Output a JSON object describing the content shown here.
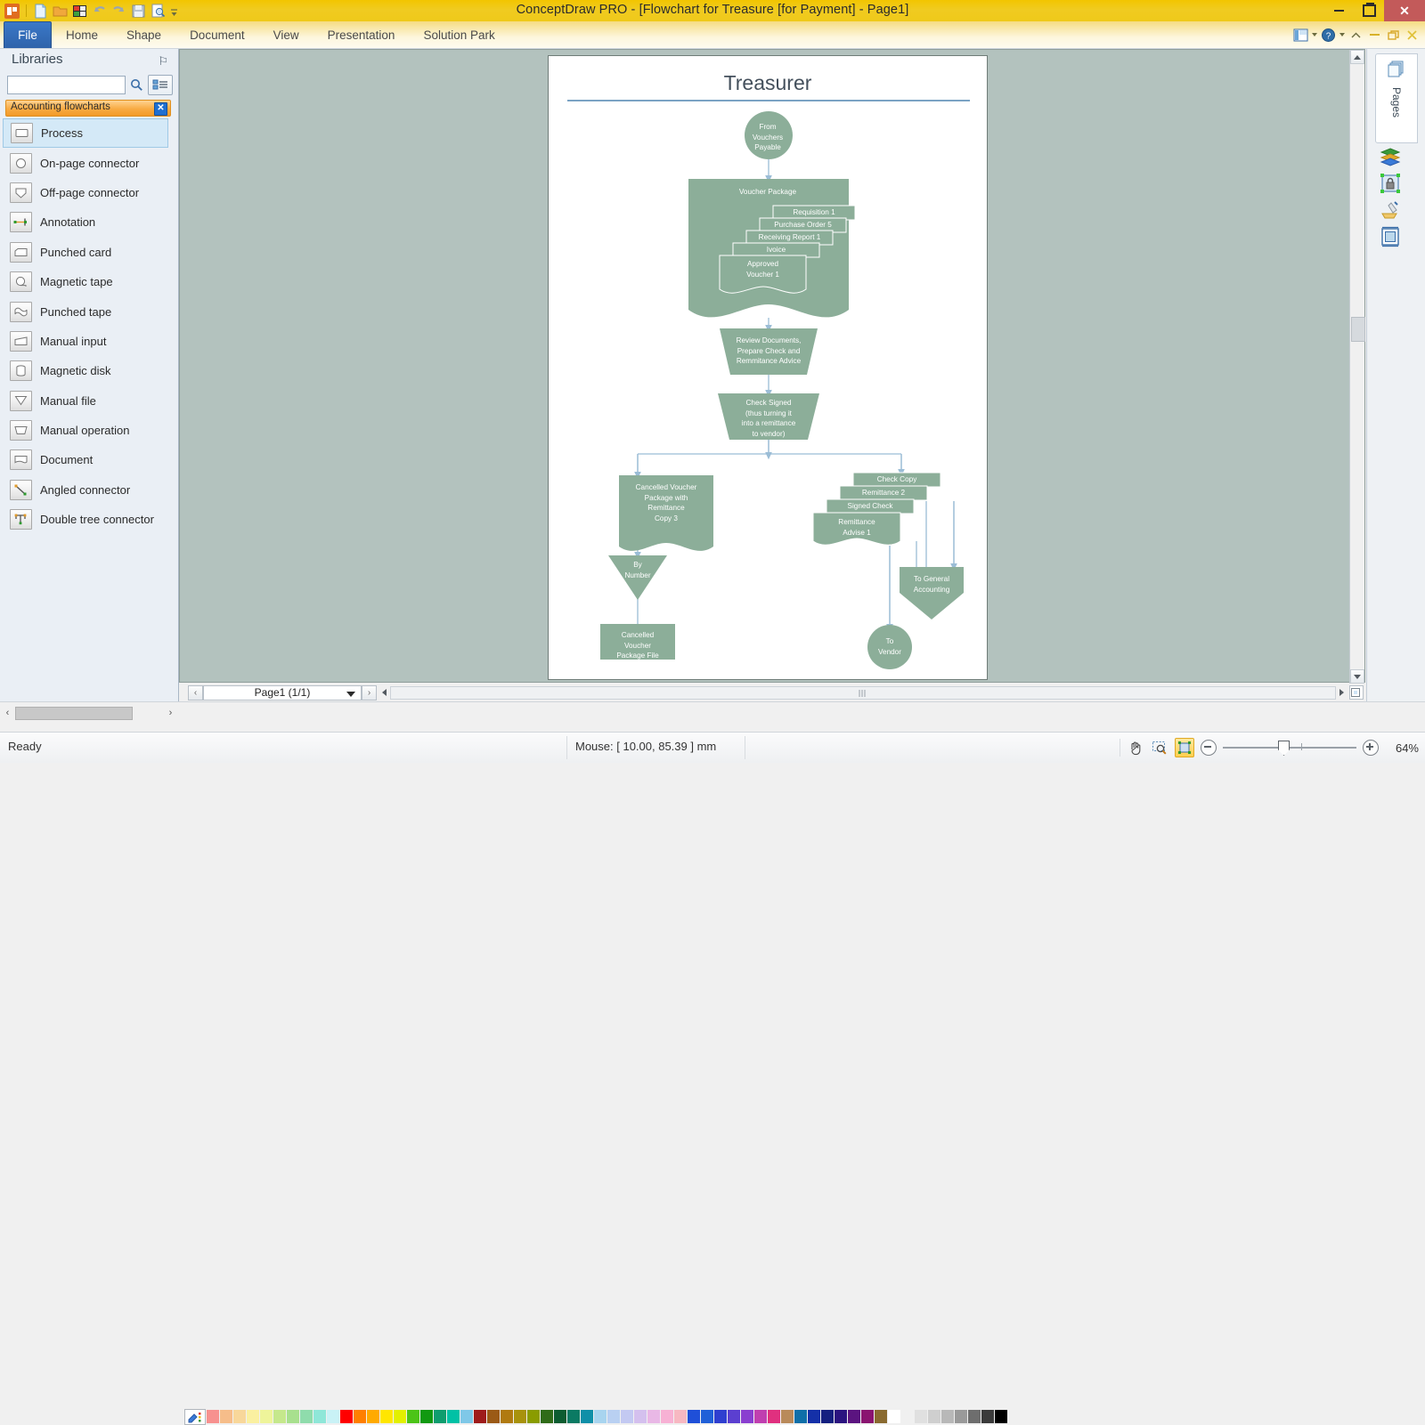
{
  "window": {
    "title": "ConceptDraw PRO - [Flowchart for Treasure [for Payment] - Page1]",
    "minimize_label": "",
    "maximize_label": "",
    "close_label": "✕"
  },
  "quick_access": [
    {
      "name": "app-logo-icon"
    },
    {
      "name": "new-document-icon"
    },
    {
      "name": "open-folder-icon"
    },
    {
      "name": "solution-park-icon"
    },
    {
      "name": "undo-icon"
    },
    {
      "name": "redo-icon"
    },
    {
      "name": "save-icon"
    },
    {
      "name": "print-preview-icon"
    },
    {
      "name": "customize-qat-icon"
    }
  ],
  "ribbon": {
    "tabs": [
      {
        "label": "File",
        "active": true
      },
      {
        "label": "Home",
        "active": false
      },
      {
        "label": "Shape",
        "active": false
      },
      {
        "label": "Document",
        "active": false
      },
      {
        "label": "View",
        "active": false
      },
      {
        "label": "Presentation",
        "active": false
      },
      {
        "label": "Solution Park",
        "active": false
      }
    ],
    "right_icons": [
      "panels-icon",
      "chevron-down-icon",
      "help-icon",
      "chevron-down-icon",
      "collapse-ribbon-icon"
    ],
    "right_window_controls": [
      "minimize-icon",
      "restore-icon",
      "close-icon"
    ]
  },
  "libraries": {
    "panel_title": "Libraries",
    "pin_glyph": "⚐",
    "search_value": "",
    "search_placeholder": "",
    "group_label": "Accounting flowcharts",
    "group_close_glyph": "✕",
    "items": [
      {
        "label": "Process",
        "icon": "process-shape-icon",
        "selected": true
      },
      {
        "label": "On-page connector",
        "icon": "on-page-connector-icon",
        "selected": false
      },
      {
        "label": "Off-page connector",
        "icon": "off-page-connector-icon",
        "selected": false
      },
      {
        "label": "Annotation",
        "icon": "annotation-icon",
        "selected": false
      },
      {
        "label": "Punched card",
        "icon": "punched-card-icon",
        "selected": false
      },
      {
        "label": "Magnetic tape",
        "icon": "magnetic-tape-icon",
        "selected": false
      },
      {
        "label": "Punched tape",
        "icon": "punched-tape-icon",
        "selected": false
      },
      {
        "label": "Manual input",
        "icon": "manual-input-icon",
        "selected": false
      },
      {
        "label": "Magnetic disk",
        "icon": "magnetic-disk-icon",
        "selected": false
      },
      {
        "label": "Manual file",
        "icon": "manual-file-icon",
        "selected": false
      },
      {
        "label": "Manual operation",
        "icon": "manual-operation-icon",
        "selected": false
      },
      {
        "label": "Document",
        "icon": "document-shape-icon",
        "selected": false
      },
      {
        "label": "Angled connector",
        "icon": "angled-connector-icon",
        "selected": false
      },
      {
        "label": "Double tree connector",
        "icon": "double-tree-connector-icon",
        "selected": false
      }
    ]
  },
  "page_bar": {
    "prev_glyph": "‹",
    "next_glyph": "›",
    "page_label": "Page1 (1/1)"
  },
  "right_panel": {
    "active_tab": "Pages",
    "icons": [
      "pages-icon",
      "layers-icon",
      "protection-icon",
      "format-painter-icon",
      "page-setup-icon"
    ]
  },
  "status_bar": {
    "ready_text": "Ready",
    "mouse_text": "Mouse: [ 10.00, 85.39 ] mm",
    "zoom_percent": "64%",
    "tools": [
      "pan-hand-icon",
      "zoom-select-icon",
      "fit-to-page-icon"
    ]
  },
  "palette": {
    "picker_icon": "color-picker-icon",
    "colors": [
      "#f7918f",
      "#f6bd8a",
      "#f8d79a",
      "#faf0a0",
      "#eef49a",
      "#c5e88c",
      "#a8e08e",
      "#8fdcac",
      "#8fe7d8",
      "#c9f2f6",
      "#ff0000",
      "#ff7f00",
      "#ffaa00",
      "#ffe600",
      "#e2f000",
      "#4cc417",
      "#119911",
      "#0f9d6e",
      "#00c1a5",
      "#7fc8e8",
      "#9e1b1b",
      "#9b5a16",
      "#b07a10",
      "#a8920c",
      "#8a9c00",
      "#2f6b18",
      "#0d5c30",
      "#0b7a63",
      "#0f8fa8",
      "#a8d4ef",
      "#b9d0f2",
      "#c3c9f2",
      "#d4c0ee",
      "#e9b8e6",
      "#f7b1d4",
      "#f7b8c2",
      "#1f4fd8",
      "#2060d8",
      "#2f3fd0",
      "#5b3fd0",
      "#8a3fd0",
      "#c03fb0",
      "#e0307f",
      "#b98a5a",
      "#0f6fa8",
      "#1430a8",
      "#141f80",
      "#2b1480",
      "#5b1480",
      "#8a1470",
      "#8a6a30",
      "#ffffff",
      "#f0f0f0",
      "#e0e0e0",
      "#cfcfcf",
      "#b8b8b8",
      "#9a9a9a",
      "#6e6e6e",
      "#3a3a3a",
      "#000000"
    ]
  },
  "chart_data": {
    "type": "diagram",
    "title": "Treasurer",
    "nodes": [
      {
        "id": "from-vouchers-payable",
        "label": "From\nVouchers\nPayable",
        "shape": "circle"
      },
      {
        "id": "voucher-package",
        "label": "Voucher Package",
        "shape": "document"
      },
      {
        "id": "requisition-1",
        "label": "Requisition 1",
        "shape": "rect"
      },
      {
        "id": "purchase-order-5",
        "label": "Purchase Order 5",
        "shape": "rect"
      },
      {
        "id": "receiving-report-1",
        "label": "Receiving Report 1",
        "shape": "rect"
      },
      {
        "id": "ivoice",
        "label": "Ivoice",
        "shape": "rect"
      },
      {
        "id": "approved-voucher-1",
        "label": "Approved\nVoucher 1",
        "shape": "document"
      },
      {
        "id": "review-documents",
        "label": "Review Documents,\nPrepare Check and\nRemmitance Advice",
        "shape": "manual-operation"
      },
      {
        "id": "check-signed",
        "label": "Check Signed\n(thus turning it\ninto a remittance\nto vendor)",
        "shape": "manual-operation"
      },
      {
        "id": "cancelled-voucher-package",
        "label": "Cancelled Voucher\nPackage with\nRemittance\nCopy 3",
        "shape": "document"
      },
      {
        "id": "by-number",
        "label": "By\nNumber",
        "shape": "manual-file"
      },
      {
        "id": "cancelled-voucher-package-file",
        "label": "Cancelled\nVoucher\nPackage File",
        "shape": "process"
      },
      {
        "id": "check-copy",
        "label": "Check Copy",
        "shape": "rect"
      },
      {
        "id": "remittance-2",
        "label": "Remittance 2",
        "shape": "rect"
      },
      {
        "id": "signed-check",
        "label": "Signed Check",
        "shape": "rect"
      },
      {
        "id": "remittance-advise-1",
        "label": "Remittance\nAdvise 1",
        "shape": "document"
      },
      {
        "id": "to-general-accounting",
        "label": "To General\nAccounting",
        "shape": "off-page-connector"
      },
      {
        "id": "to-vendor",
        "label": "To\nVendor",
        "shape": "circle"
      }
    ],
    "edges": [
      {
        "from": "from-vouchers-payable",
        "to": "voucher-package"
      },
      {
        "from": "voucher-package",
        "to": "review-documents"
      },
      {
        "from": "review-documents",
        "to": "check-signed"
      },
      {
        "from": "check-signed",
        "to": "cancelled-voucher-package"
      },
      {
        "from": "check-signed",
        "to": "check-copy"
      },
      {
        "from": "cancelled-voucher-package",
        "to": "by-number"
      },
      {
        "from": "by-number",
        "to": "cancelled-voucher-package-file"
      },
      {
        "from": "check-copy",
        "to": "to-general-accounting"
      },
      {
        "from": "remittance-advise-1",
        "to": "to-vendor"
      }
    ],
    "colors": {
      "shape_fill": "#8cae99",
      "connector": "#9bbdd6",
      "title": "#44505c",
      "rule": "#7ba3c4"
    }
  }
}
